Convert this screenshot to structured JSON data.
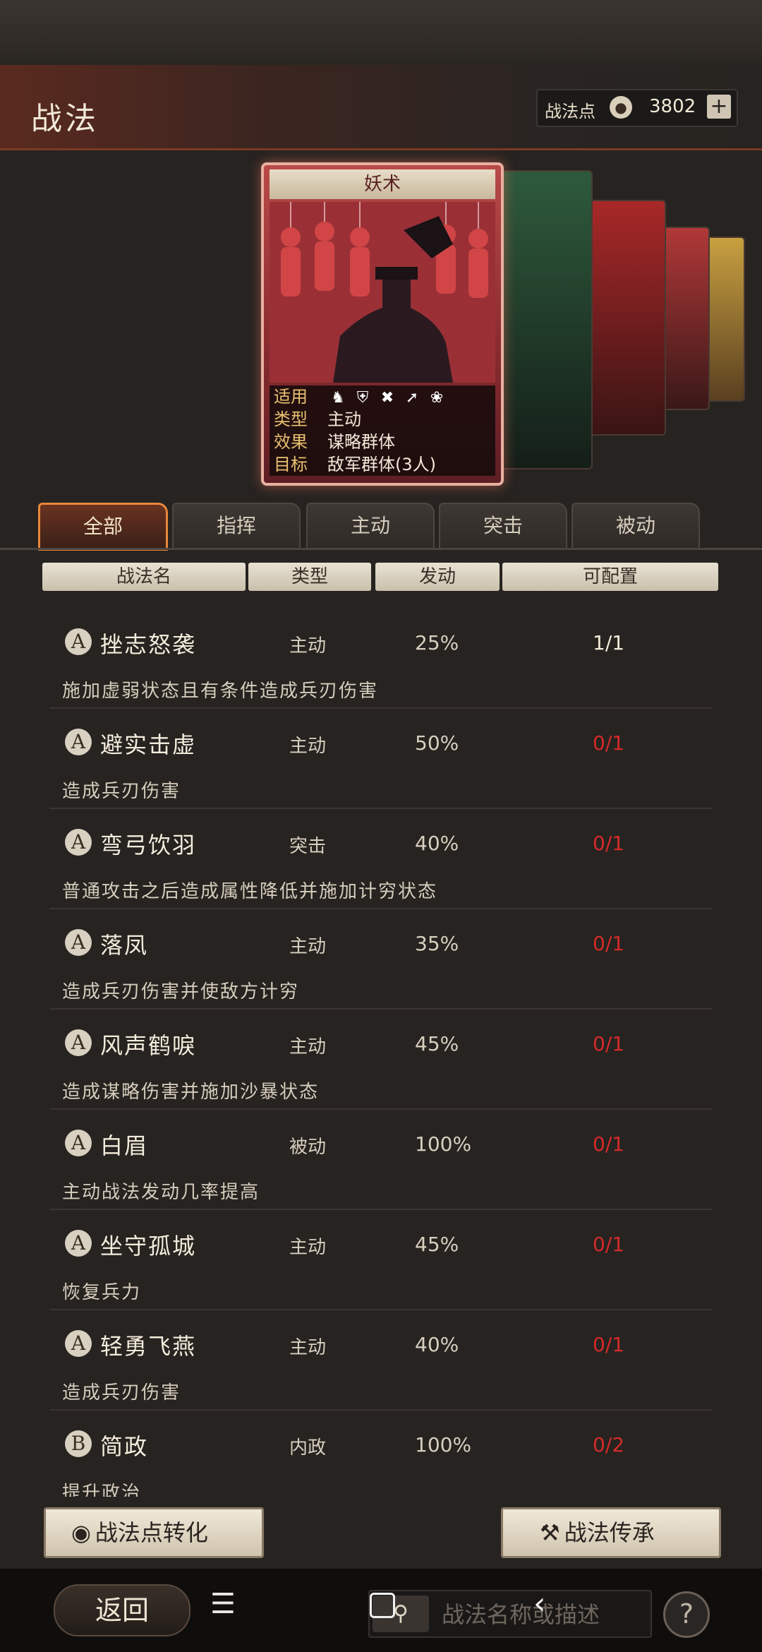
{
  "header": {
    "title": "战法",
    "points_label": "战法点",
    "points_value": "3802",
    "plus_label": "+"
  },
  "card": {
    "name": "妖术",
    "rows": [
      {
        "key": "适用",
        "value": ""
      },
      {
        "key": "类型",
        "value": "主动"
      },
      {
        "key": "效果",
        "value": "谋略群体"
      },
      {
        "key": "目标",
        "value": "敌军群体(3人)"
      }
    ],
    "troop_icons": [
      "cavalry-icon",
      "shield-icon",
      "bow-icon",
      "spear-icon",
      "wheel-icon"
    ]
  },
  "tabs": [
    {
      "label": "全部",
      "active": true
    },
    {
      "label": "指挥",
      "active": false
    },
    {
      "label": "主动",
      "active": false
    },
    {
      "label": "突击",
      "active": false
    },
    {
      "label": "被动",
      "active": false
    }
  ],
  "columns": {
    "name": "战法名",
    "type": "类型",
    "rate": "发动",
    "config": "可配置"
  },
  "skills": [
    {
      "grade": "A",
      "name": "挫志怒袭",
      "type": "主动",
      "rate": "25%",
      "config": "1/1",
      "desc": "施加虚弱状态且有条件造成兵刃伤害"
    },
    {
      "grade": "A",
      "name": "避实击虚",
      "type": "主动",
      "rate": "50%",
      "config": "0/1",
      "desc": "造成兵刃伤害"
    },
    {
      "grade": "A",
      "name": "弯弓饮羽",
      "type": "突击",
      "rate": "40%",
      "config": "0/1",
      "desc": "普通攻击之后造成属性降低并施加计穷状态"
    },
    {
      "grade": "A",
      "name": "落凤",
      "type": "主动",
      "rate": "35%",
      "config": "0/1",
      "desc": "造成兵刃伤害并使敌方计穷"
    },
    {
      "grade": "A",
      "name": "风声鹤唳",
      "type": "主动",
      "rate": "45%",
      "config": "0/1",
      "desc": "造成谋略伤害并施加沙暴状态"
    },
    {
      "grade": "A",
      "name": "白眉",
      "type": "被动",
      "rate": "100%",
      "config": "0/1",
      "desc": "主动战法发动几率提高"
    },
    {
      "grade": "A",
      "name": "坐守孤城",
      "type": "主动",
      "rate": "45%",
      "config": "0/1",
      "desc": "恢复兵力"
    },
    {
      "grade": "A",
      "name": "轻勇飞燕",
      "type": "主动",
      "rate": "40%",
      "config": "0/1",
      "desc": "造成兵刃伤害"
    },
    {
      "grade": "B",
      "name": "简政",
      "type": "内政",
      "rate": "100%",
      "config": "0/2",
      "desc": "提升政治"
    }
  ],
  "colors": {
    "config_available": "#f2ead8",
    "config_empty": "#d42a2a",
    "accent": "#e8883a"
  },
  "buttons": {
    "convert": "战法点转化",
    "inherit": "战法传承"
  },
  "nav": {
    "back": "返回",
    "search_placeholder": "战法名称或描述",
    "help": "?"
  }
}
